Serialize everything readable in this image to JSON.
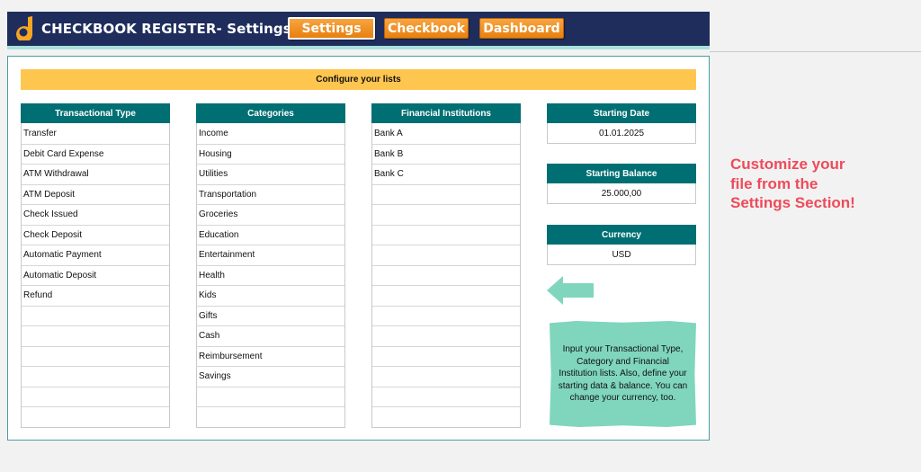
{
  "header": {
    "title": "CHECKBOOK REGISTER- Settings",
    "nav": [
      "Settings",
      "Checkbook",
      "Dashboard"
    ],
    "active": "Settings",
    "brand_color": "#1f2d5c",
    "button_color": "#f08c1e"
  },
  "config_title": "Configure your lists",
  "lists": {
    "transactional_type": {
      "title": "Transactional Type",
      "items": [
        "Transfer",
        "Debit Card Expense",
        "ATM Withdrawal",
        "ATM Deposit",
        "Check Issued",
        "Check Deposit",
        "Automatic Payment",
        "Automatic Deposit",
        "Refund",
        "",
        "",
        "",
        "",
        "",
        ""
      ]
    },
    "categories": {
      "title": "Categories",
      "items": [
        "Income",
        "Housing",
        "Utilities",
        "Transportation",
        "Groceries",
        "Education",
        "Entertainment",
        "Health",
        "Kids",
        "Gifts",
        "Cash",
        "Reimbursement",
        "Savings",
        "",
        ""
      ]
    },
    "financial_institutions": {
      "title": "Financial Institutions",
      "items": [
        "Bank A",
        "Bank B",
        "Bank C",
        "",
        "",
        "",
        "",
        "",
        "",
        "",
        "",
        "",
        "",
        "",
        ""
      ]
    }
  },
  "starting_date": {
    "title": "Starting Date",
    "value": "01.01.2025"
  },
  "starting_balance": {
    "title": "Starting Balance",
    "value": "25.000,00"
  },
  "currency": {
    "title": "Currency",
    "value": "USD"
  },
  "note": "Input your Transactional Type, Category and Financial Institution lists. Also, define your starting data & balance. You can change your currency, too.",
  "promo": "Customize your file from the Settings Section!",
  "colors": {
    "teal_header": "#006f73",
    "config_bar": "#ffc64f",
    "note_bg": "#7fd6bd",
    "promo_text": "#ee4b5a",
    "arrow": "#7fd6bd"
  }
}
